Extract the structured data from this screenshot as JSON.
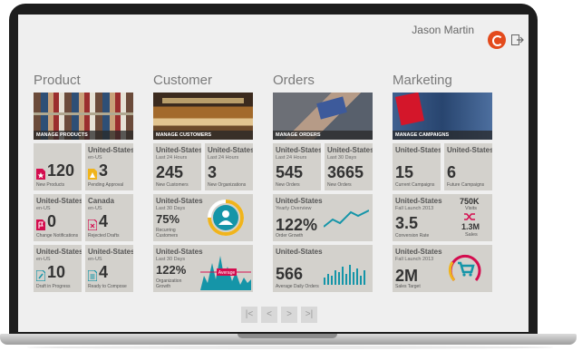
{
  "header": {
    "user_name": "Jason Martin"
  },
  "colors": {
    "accent": "#d40d4f",
    "teal": "#1595a8",
    "brand": "#e34a1c",
    "tile": "#d3d1cc"
  },
  "columns": [
    {
      "title": "Product",
      "banner": "MANAGE PRODUCTS",
      "tiles": [
        {
          "region": "",
          "sub": "",
          "value": "120",
          "label": "New Products",
          "icon": "doc-star-icon"
        },
        {
          "region": "United-States",
          "sub": "en-US",
          "value": "3",
          "label": "Pending Approval",
          "icon": "doc-alert-icon"
        },
        {
          "region": "United-States",
          "sub": "en-US",
          "value": "0",
          "label": "Change Notifications",
          "icon": "doc-flag-icon"
        },
        {
          "region": "Canada",
          "sub": "en-US",
          "value": "4",
          "label": "Rejected Drafts",
          "icon": "doc-x-icon"
        },
        {
          "region": "United-States",
          "sub": "en-US",
          "value": "10",
          "label": "Draft in Progress",
          "icon": "doc-pen-icon"
        },
        {
          "region": "United-States",
          "sub": "en-US",
          "value": "4",
          "label": "Ready to Compose",
          "icon": "doc-list-icon"
        }
      ]
    },
    {
      "title": "Customer",
      "banner": "MANAGE CUSTOMERS",
      "tiles": [
        {
          "region": "United-States",
          "sub": "Last 24 Hours",
          "value": "245",
          "label": "New Customers"
        },
        {
          "region": "United-States",
          "sub": "Last 24 Hours",
          "value": "3",
          "label": "New Organizations"
        },
        {
          "region": "United-States",
          "sub": "Last 30 Days",
          "value": "75%",
          "label": "Recurring\nCustomers",
          "icon": "user-icon"
        },
        {
          "region": "United-States",
          "sub": "Last 30 Days",
          "value": "122%",
          "label": "Organization\nGrowth",
          "badge": "Average"
        }
      ]
    },
    {
      "title": "Orders",
      "banner": "MANAGE ORDERS",
      "tiles": [
        {
          "region": "United-States",
          "sub": "Last 24 Hours",
          "value": "545",
          "label": "New Orders"
        },
        {
          "region": "United-States",
          "sub": "Last 30 Days",
          "value": "3665",
          "label": "New Orders"
        },
        {
          "region": "United-States",
          "sub": "Yearly Overview",
          "value": "122%",
          "label": "Order Growth"
        },
        {
          "region": "United-States",
          "sub": "",
          "value": "566",
          "label": "Average Daily Orders"
        }
      ]
    },
    {
      "title": "Marketing",
      "banner": "MANAGE CAMPAIGNS",
      "tiles": [
        {
          "region": "United-States",
          "sub": "",
          "value": "15",
          "label": "Current Campaigns"
        },
        {
          "region": "United-States",
          "sub": "",
          "value": "6",
          "label": "Future Campaigns"
        },
        {
          "region": "United-States",
          "sub": "Fall Launch 2013",
          "value": "3.5",
          "label": "Conversion Rate",
          "v2": "750K",
          "v2label": "Visits",
          "v3": "1.3M",
          "v3label": "Sales",
          "icon": "shuffle-icon"
        },
        {
          "region": "United-States",
          "sub": "Fall Launch 2013",
          "value": "2M",
          "label": "Sales Target",
          "icon": "cart-icon"
        }
      ]
    }
  ],
  "pager": {
    "first": "|<",
    "prev": "<",
    "next": ">",
    "last": ">|"
  }
}
